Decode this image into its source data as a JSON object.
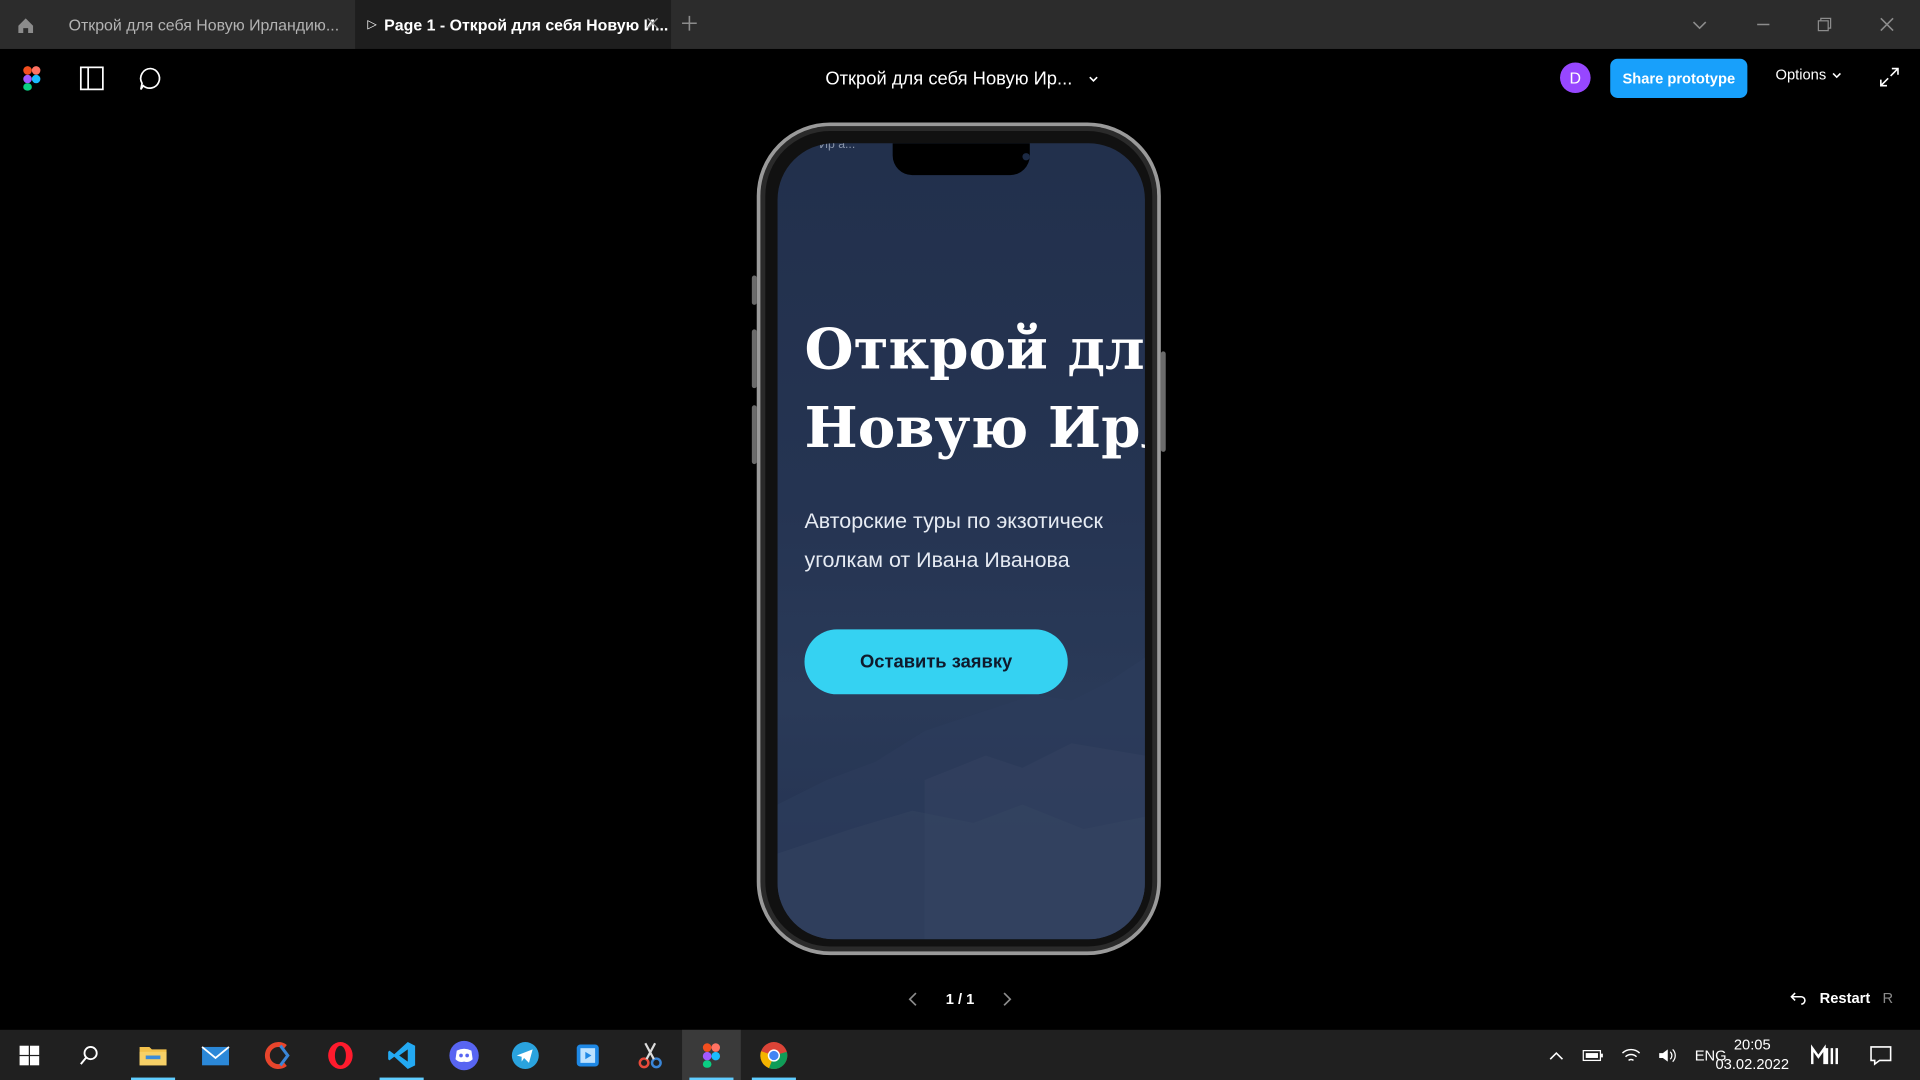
{
  "browser": {
    "tabs": [
      {
        "label": "Открой для себя Новую Ирландию..."
      },
      {
        "label": "Page 1 - Открой для себя Новую И..."
      }
    ]
  },
  "toolbar": {
    "file_title": "Открой для себя Новую Ир...",
    "avatar_initial": "D",
    "share_label": "Share prototype",
    "options_label": "Options"
  },
  "prototype": {
    "peek_text": "Ир а...",
    "hero_title_line1": "Открой для",
    "hero_title_line2": "Новую Ирла",
    "subtitle_line1": "Авторские туры по экзотическ",
    "subtitle_line2": "уголкам от Ивана Иванова",
    "cta_label": "Оставить заявку"
  },
  "pager": {
    "label": "1 / 1"
  },
  "restart": {
    "label": "Restart",
    "key": "R"
  },
  "taskbar": {
    "apps": [
      "start-icon",
      "search-icon",
      "file-explorer-icon",
      "mail-icon",
      "ccleaner-icon",
      "opera-icon",
      "vscode-icon",
      "discord-icon",
      "telegram-icon",
      "media-player-icon",
      "snipping-icon",
      "figma-icon",
      "chrome-icon"
    ],
    "lang": "ENG",
    "time": "20:05",
    "date": "03.02.2022"
  },
  "colors": {
    "accent": "#18a0fb",
    "cta": "#35d2f2",
    "avatar": "#9747ff"
  }
}
